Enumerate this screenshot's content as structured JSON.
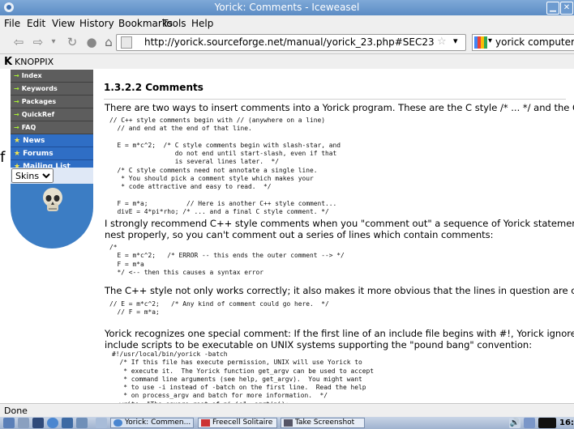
{
  "window": {
    "title": "Yorick: Comments - Iceweasel"
  },
  "menu": [
    "File",
    "Edit",
    "View",
    "History",
    "Bookmarks",
    "Tools",
    "Help"
  ],
  "nav": {
    "url": "http://yorick.sourceforge.net/manual/yorick_23.php#SEC23",
    "search_value": "yorick computer langu"
  },
  "bookmarks": {
    "item": "KNOPPIX"
  },
  "sidebar": {
    "links": [
      "Index",
      "Keywords",
      "Packages",
      "QuickRef",
      "FAQ"
    ],
    "sections": [
      "News",
      "Forums",
      "Mailing List"
    ],
    "skins_label": "Skins",
    "stray_text": "f"
  },
  "content": {
    "heading": "1.3.2.2 Comments",
    "p1": "There are two ways to insert comments into a Yorick program. These are the C style /* ... */ and the C++ style //:",
    "code1": "// C++ style comments begin with // (anywhere on a line)\n  // and end at the end of that line.\n\n  E = m*c^2;  /* C style comments begin with slash-star, and\n                 do not end until start-slash, even if that\n                 is several lines later.  */\n  /* C style comments need not annotate a single line.\n   * You should pick a comment style which makes your\n   * code attractive and easy to read.  */\n\n  F = m*a;          // Here is another C++ style comment...\n  divE = 4*pi*rho; /* ... and a final C style comment. */",
    "p2": "I strongly recommend C++ style comments when you \"comment out\" a sequence of Yorick statements. C style comments do not\nnest properly, so you can't comment out a series of lines which contain comments:",
    "code2": "/*\n  E = m*c^2;   /* ERROR -- this ends the outer comment --> */\n  F = m*a\n  */ <-- then this causes a syntax error",
    "p3": "The C++ style not only works correctly; it also makes it more obvious that the lines in question are comments:",
    "code3": "// E = m*c^2;   /* Any kind of comment could go here.  */\n  // F = m*a;",
    "p4": "Yorick recognizes one special comment: If the first line of an include file begins with #!, Yorick ignores that line. This allows Yorick\ninclude scripts to be executable on UNIX systems supporting the \"pound bang\" convention:",
    "code4": "#!/usr/local/bin/yorick -batch\n  /* If this file has execute permission, UNIX will use Yorick to\n   * execute it.  The Yorick function get_argv can be used to accept\n   * command line arguments (see help, get_argv).  You might want\n   * to use -i instead of -batch on the first line.  Read the help\n   * on process_argv and batch for more information.  */\n  write, \"The square root of pi is\", sqrt(pi);"
  },
  "status": {
    "text": "Done"
  },
  "taskbar": {
    "tasks": [
      "Yorick: Commen...",
      "Freecell Solitaire",
      "Take Screenshot"
    ],
    "clock": "16:"
  },
  "colors": {
    "titlebar": "#5b8cc4",
    "sidebar_dark": "#5d5d5d",
    "sidebar_blue": "#2f6ec5",
    "arrow_green": "#a8ef35"
  }
}
